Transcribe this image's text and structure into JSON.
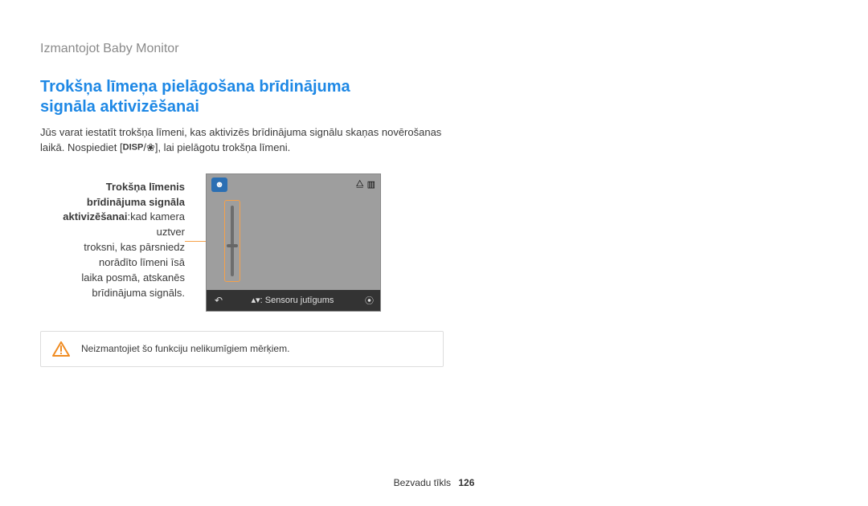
{
  "chapter": "Izmantojot Baby Monitor",
  "section_title": "Trokšņa līmeņa pielāgošana brīdinājuma signāla aktivizēšanai",
  "intro_prefix": "Jūs varat iestatīt trokšņa līmeni, kas aktivizēs brīdinājuma signālu skaņas novērošanas laikā. Nospiediet [",
  "intro_disp": "DISP",
  "intro_sep": "/",
  "intro_flower": "❀",
  "intro_suffix": "], lai pielāgotu trokšņa līmeni.",
  "callout": {
    "title_l1": "Trokšņa līmenis",
    "title_l2": "brīdinājuma signāla",
    "title_l3": "aktivizēšanai",
    "body_l1": "kad kamera uztver",
    "body_l2": " troksni, kas pārsniedz",
    "body_l3": " norādīto līmeni īsā",
    "body_l4": " laika posmā, atskanēs",
    "body_l5": " brīdinājuma signāls."
  },
  "device": {
    "badge_icon": "☻",
    "wifi_icon": "⧋",
    "battery_icon": "▥",
    "back_icon": "↶",
    "bottom_label_prefix": "▴▾",
    "bottom_label": ": Sensoru jutīgums",
    "broadcast_icon": "⦿"
  },
  "warning_text": "Neizmantojiet šo funkciju nelikumīgiem mērķiem.",
  "footer_section": "Bezvadu tīkls",
  "page_number": "126"
}
